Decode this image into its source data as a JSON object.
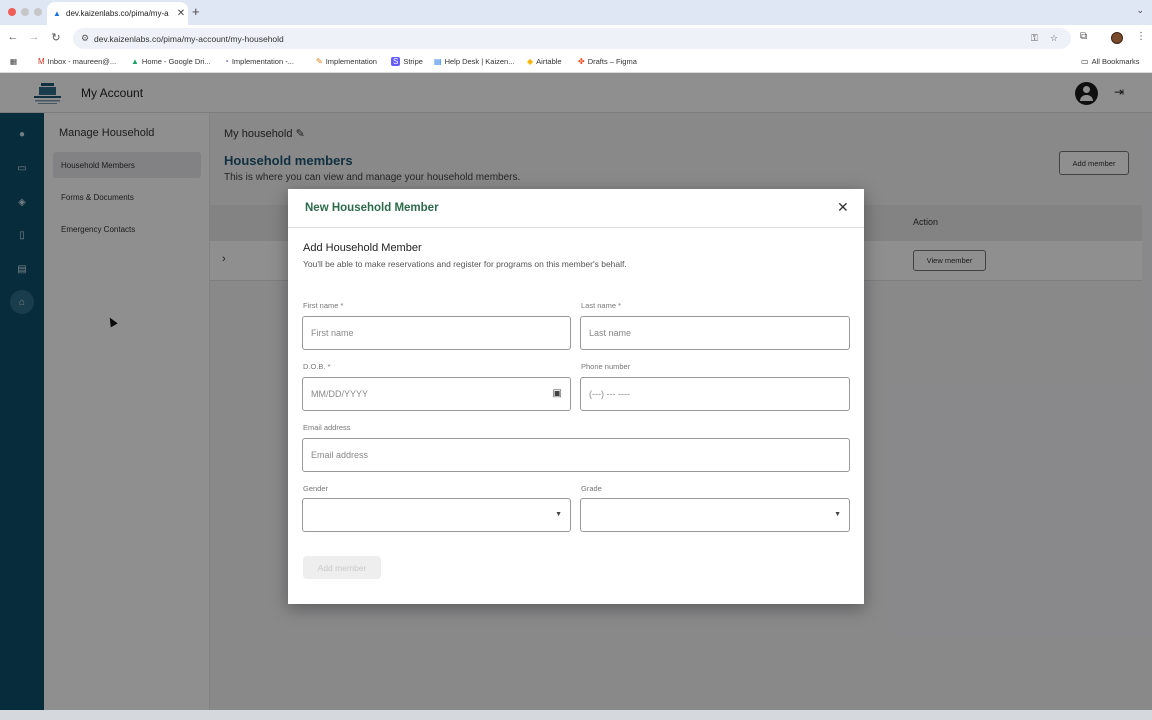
{
  "browser": {
    "tab_title": "dev.kaizenlabs.co/pima/my-a",
    "url": "dev.kaizenlabs.co/pima/my-account/my-household",
    "bookmarks": [
      "Inbox - maureen@...",
      "Home - Google Dri...",
      "Implementation -...",
      "Implementation",
      "Stripe",
      "Help Desk | Kaizen...",
      "Airtable",
      "Drafts – Figma"
    ],
    "all_bookmarks": "All Bookmarks"
  },
  "header": {
    "title": "My Account"
  },
  "subnav": {
    "title": "Manage Household",
    "items": [
      "Household Members",
      "Forms & Documents",
      "Emergency Contacts"
    ]
  },
  "main": {
    "breadcrumb": "My household",
    "section_title": "Household members",
    "section_subtitle": "This is where you can view and manage your household members.",
    "add_member_label": "Add member",
    "table_action_header": "Action",
    "view_member_label": "View member"
  },
  "modal": {
    "title": "New Household Member",
    "heading": "Add Household Member",
    "subheading": "You'll be able to make reservations and register for programs on this member's behalf.",
    "fields": {
      "first_name": {
        "label": "First name *",
        "placeholder": "First name"
      },
      "last_name": {
        "label": "Last name *",
        "placeholder": "Last name"
      },
      "dob": {
        "label": "D.O.B. *",
        "placeholder": "MM/DD/YYYY"
      },
      "phone": {
        "label": "Phone number",
        "placeholder": "(---) --- ----"
      },
      "email": {
        "label": "Email address",
        "placeholder": "Email address"
      },
      "gender": {
        "label": "Gender",
        "value": ""
      },
      "grade": {
        "label": "Grade",
        "value": ""
      }
    },
    "submit_label": "Add member"
  },
  "colors": {
    "rail": "#0d4f6c",
    "accent_title": "#1f5673",
    "modal_title": "#2d6a4a"
  }
}
